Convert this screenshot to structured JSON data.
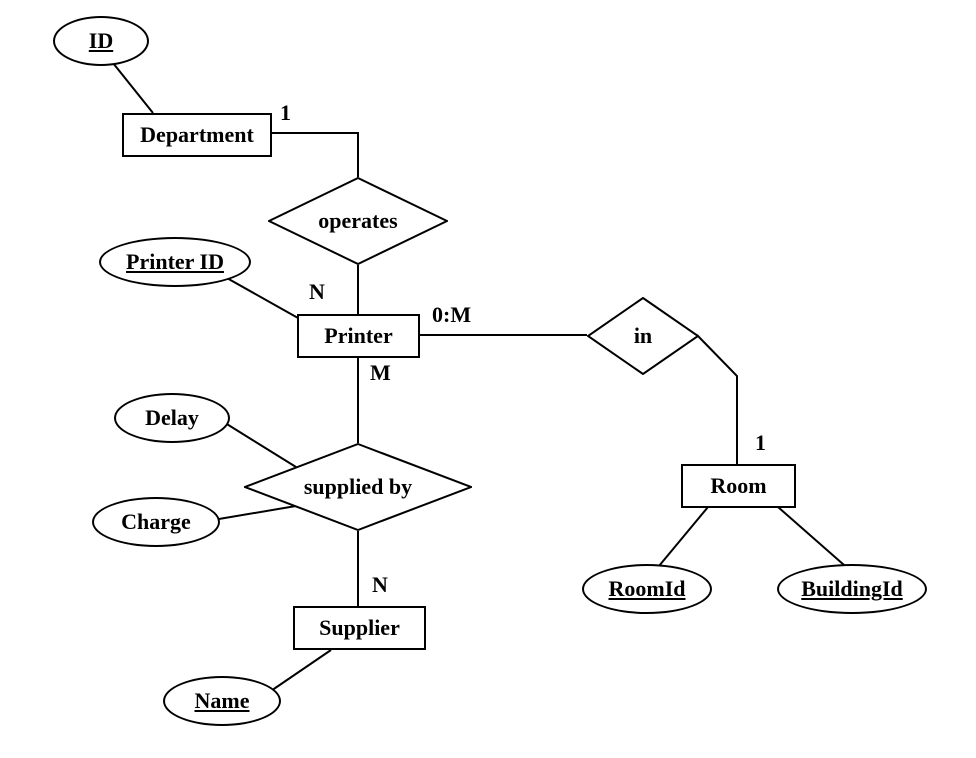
{
  "entities": {
    "department": "Department",
    "printer": "Printer",
    "supplier": "Supplier",
    "room": "Room"
  },
  "relationships": {
    "operates": "operates",
    "in": "in",
    "supplied_by": "supplied by"
  },
  "attributes": {
    "id": "ID",
    "printer_id": "Printer ID",
    "delay": "Delay",
    "charge": "Charge",
    "name": "Name",
    "room_id": "RoomId",
    "building_id": "BuildingId"
  },
  "cardinalities": {
    "dept_operates": "1",
    "operates_printer": "N",
    "printer_in": "0:M",
    "in_room": "1",
    "printer_supplied": "M",
    "supplied_supplier": "N"
  }
}
